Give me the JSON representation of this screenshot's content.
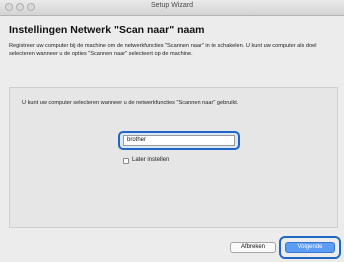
{
  "window": {
    "title": "Setup Wizard"
  },
  "page": {
    "heading": "Instellingen Netwerk \"Scan naar\" naam",
    "intro": "Registreer uw computer bij de machine om de netwerkfuncties \"Scannen naar\" in te schakelen. U kunt uw computer als doel selecteren wanneer u de opties \"Scannen naar\" selecteert op de machine.",
    "panel_text": "U kunt uw computer selecteren wanneer u de netwerkfuncties \"Scannen naar\" gebruikt."
  },
  "form": {
    "name_value": "brother",
    "later_label": "Later instellen",
    "later_checked": false
  },
  "buttons": {
    "cancel_label": "Afbreken",
    "next_label": "Volgende"
  },
  "colors": {
    "accent": "#1f66c6",
    "default_button": "#5b9cf5"
  }
}
